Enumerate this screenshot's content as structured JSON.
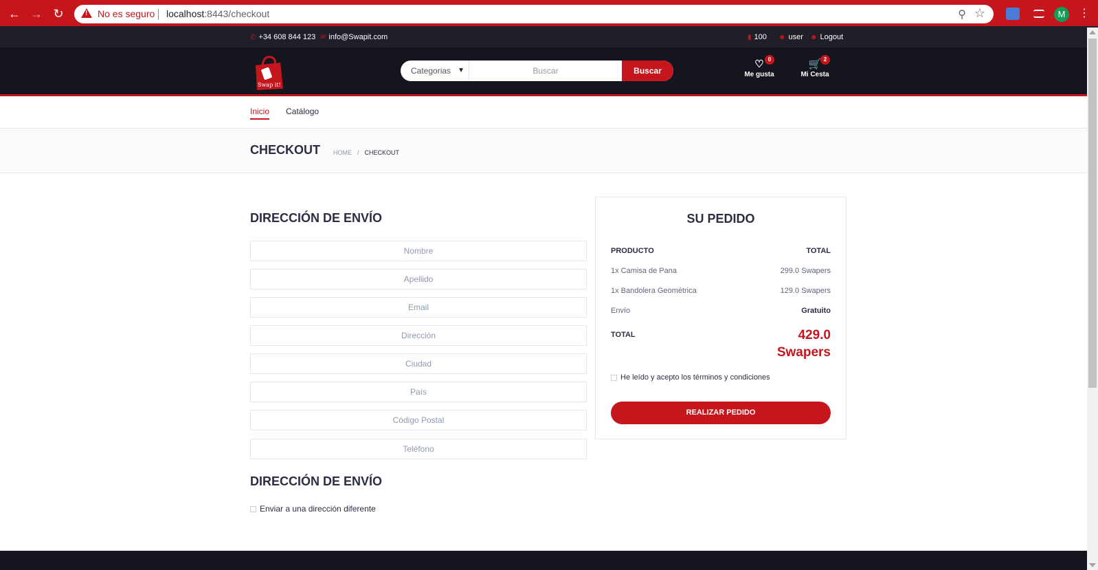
{
  "browser": {
    "insecure_label": "No es seguro",
    "url_host": "localhost",
    "url_rest": ":8443/checkout",
    "avatar_letter": "M"
  },
  "topbar": {
    "phone": "+34 608 844 123",
    "email": "info@Swapit.com",
    "balance": "100",
    "user": "user",
    "logout": "Logout"
  },
  "header": {
    "logo_text": "Swap it!",
    "categories_label": "Categorias",
    "search_placeholder": "Buscar",
    "search_button": "Buscar",
    "wishlist_label": "Me gusta",
    "wishlist_count": "0",
    "cart_label": "Mi Cesta",
    "cart_count": "2"
  },
  "nav": {
    "items": [
      {
        "label": "Inicio"
      },
      {
        "label": "Catálogo"
      }
    ]
  },
  "breadcrumb": {
    "title": "CHECKOUT",
    "home": "HOME",
    "separator": "/",
    "current": "CHECKOUT"
  },
  "billing": {
    "title": "DIRECCIÓN DE ENVÍO",
    "fields": {
      "nombre": "Nombre",
      "apellido": "Apellido",
      "email": "Email",
      "direccion": "Dirección",
      "ciudad": "Ciudad",
      "pais": "País",
      "codigo_postal": "Código Postal",
      "telefono": "Teléfono"
    }
  },
  "shipping": {
    "title": "DIRECCIÓN DE ENVÍO",
    "different_address_label": "Enviar a una dirección diferente"
  },
  "order": {
    "title": "SU PEDIDO",
    "col_product": "PRODUCTO",
    "col_total": "TOTAL",
    "items": [
      {
        "name": "1x Camisa de Pana",
        "price": "299.0 Swapers"
      },
      {
        "name": "1x Bandolera Geométrica",
        "price": "129.0 Swapers"
      }
    ],
    "shipping_label": "Envío",
    "shipping_value": "Gratuito",
    "total_label": "TOTAL",
    "total_value": "429.0 Swapers",
    "terms_label": "He leído y acepto los términos y condiciones",
    "place_order": "REALIZAR PEDIDO"
  },
  "colors": {
    "accent": "#c4161c",
    "dark": "#15161d",
    "topbar": "#1e1f29"
  }
}
